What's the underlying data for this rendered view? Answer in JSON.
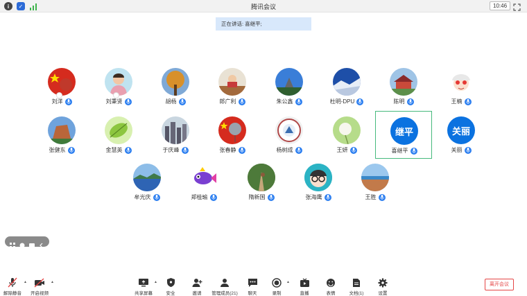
{
  "window": {
    "title": "腾讯会议",
    "time": "10:46"
  },
  "speaking": "正在讲话: 喜继平;",
  "participants": [
    {
      "name": "刘洋",
      "avatar": "flag",
      "badge": true
    },
    {
      "name": "刘秉贤",
      "avatar": "photo-woman",
      "badge": true
    },
    {
      "name": "胡杨",
      "avatar": "photo-tree"
    },
    {
      "name": "郎广利",
      "avatar": "photo-desk"
    },
    {
      "name": "朱公鑫",
      "avatar": "photo-sky"
    },
    {
      "name": "杜明-DPU",
      "avatar": "photo-blue"
    },
    {
      "name": "陈明",
      "avatar": "photo-temple"
    },
    {
      "name": "王楠",
      "avatar": "cartoon-girl"
    },
    {
      "name": "张健东",
      "avatar": "photo-rock"
    },
    {
      "name": "金慧英",
      "avatar": "photo-leaf"
    },
    {
      "name": "于庆峰",
      "avatar": "photo-city"
    },
    {
      "name": "张春静",
      "avatar": "flag-balloon"
    },
    {
      "name": "杨树成",
      "avatar": "logo-seal"
    },
    {
      "name": "王妍",
      "avatar": "photo-dandelion"
    },
    {
      "name": "喜继平",
      "avatar": "text",
      "avatar_text": "继平",
      "active": true
    },
    {
      "name": "关丽",
      "avatar": "text",
      "avatar_text": "关丽"
    },
    {
      "name": "牟光庆",
      "avatar": "photo-lake"
    },
    {
      "name": "郑桂瑜",
      "avatar": "cartoon-fish"
    },
    {
      "name": "隋新国",
      "avatar": "photo-path"
    },
    {
      "name": "张海鹰",
      "avatar": "cartoon-glasses"
    },
    {
      "name": "王胜",
      "avatar": "photo-coast"
    }
  ],
  "toolbar": {
    "unmute": "解除静音",
    "start_video": "开启视频",
    "share_screen": "共享屏幕",
    "security": "安全",
    "invite": "邀请",
    "manage_members": "管理成员(21)",
    "chat": "聊天",
    "record": "录制",
    "live": "直播",
    "reactions": "表情",
    "docs": "文档(1)",
    "settings": "设置",
    "leave": "离开会议"
  },
  "colors": {
    "accent": "#0b72e0",
    "active_border": "#45b97c",
    "leave": "#e54545",
    "speaking_bg": "#d8e8fb"
  }
}
